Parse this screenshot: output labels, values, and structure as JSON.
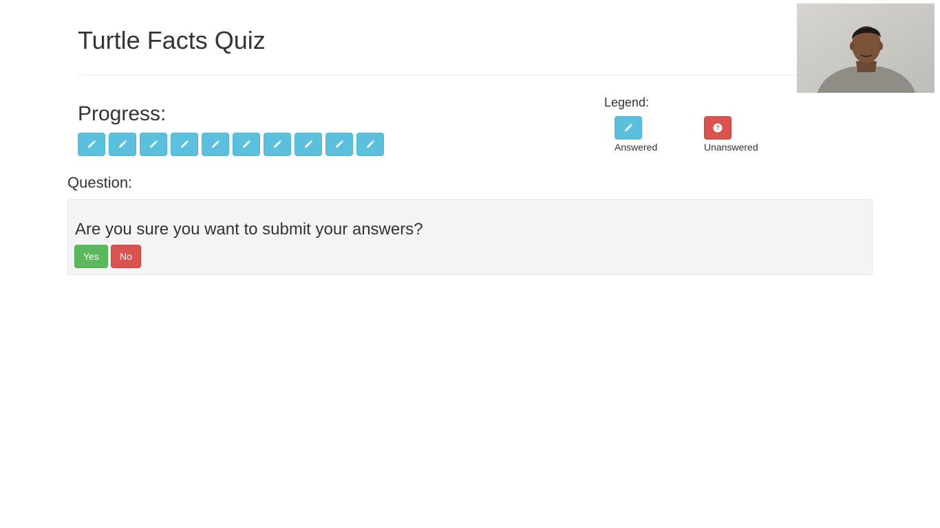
{
  "header": {
    "title": "Turtle Facts Quiz"
  },
  "progress": {
    "heading": "Progress:",
    "items": [
      {
        "status": "answered",
        "icon": "pencil-icon"
      },
      {
        "status": "answered",
        "icon": "pencil-icon"
      },
      {
        "status": "answered",
        "icon": "pencil-icon"
      },
      {
        "status": "answered",
        "icon": "pencil-icon"
      },
      {
        "status": "answered",
        "icon": "pencil-icon"
      },
      {
        "status": "answered",
        "icon": "pencil-icon"
      },
      {
        "status": "answered",
        "icon": "pencil-icon"
      },
      {
        "status": "answered",
        "icon": "pencil-icon"
      },
      {
        "status": "answered",
        "icon": "pencil-icon"
      },
      {
        "status": "answered",
        "icon": "pencil-icon"
      }
    ]
  },
  "legend": {
    "label": "Legend:",
    "answered": {
      "caption": "Answered",
      "icon": "pencil-icon",
      "color": "#5bc0de"
    },
    "unanswered": {
      "caption": "Unanswered",
      "icon": "question-circle-icon",
      "color": "#d9534f"
    }
  },
  "question": {
    "label": "Question:",
    "text": "Are you sure you want to submit your answers?",
    "yes_label": "Yes",
    "no_label": "No"
  },
  "colors": {
    "info": "#5bc0de",
    "success": "#5cb85c",
    "danger": "#d9534f",
    "panel": "#f4f4f4"
  }
}
